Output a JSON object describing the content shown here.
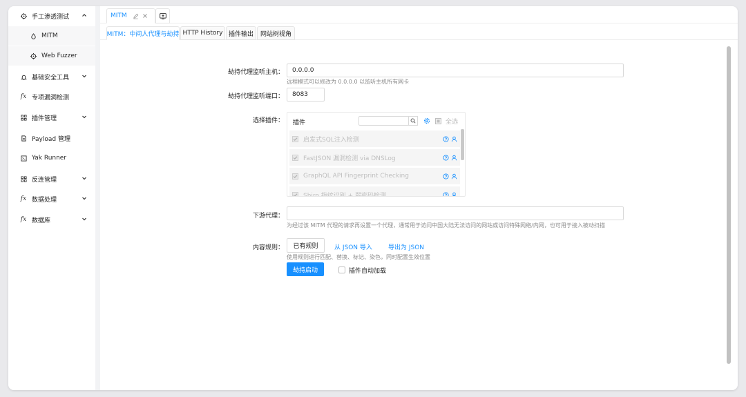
{
  "sidebar": {
    "items": [
      {
        "label": "手工渗透测试",
        "icon": "crosshair-icon",
        "expanded": true
      },
      {
        "label": "MITM",
        "icon": "drop-icon",
        "sub": true
      },
      {
        "label": "Web Fuzzer",
        "icon": "crosshair-icon",
        "sub": true
      },
      {
        "label": "基础安全工具",
        "icon": "bell-icon",
        "chevron": true
      },
      {
        "label": "专项漏洞检测",
        "icon": "fx-icon"
      },
      {
        "label": "插件管理",
        "icon": "grid-icon",
        "chevron": true
      },
      {
        "label": "Payload 管理",
        "icon": "file-icon"
      },
      {
        "label": "Yak Runner",
        "icon": "terminal-icon"
      },
      {
        "label": "反连管理",
        "icon": "grid-icon",
        "chevron": true
      },
      {
        "label": "数据处理",
        "icon": "fx-icon",
        "chevron": true
      },
      {
        "label": "数据库",
        "icon": "fx-icon",
        "chevron": true
      }
    ]
  },
  "tabs": {
    "main_tab": "MITM",
    "sub_tabs": [
      "MITM：中间人代理与劫持",
      "HTTP History",
      "插件输出",
      "网站树视角"
    ]
  },
  "form": {
    "host_label": "劫持代理监听主机：",
    "host_value": "0.0.0.0",
    "host_help": "远程模式可以修改为 0.0.0.0 以监听主机所有网卡",
    "port_label": "劫持代理监听端口：",
    "port_value": "8083",
    "plugin_label": "选择插件：",
    "plugin_box": {
      "title": "插件",
      "select_all": "全选",
      "items": [
        "启发式SQL注入检测",
        "FastJSON 漏洞检测 via DNSLog",
        "GraphQL API Fingerprint Checking",
        "Shiro 指纹识别 + 弱密码检测"
      ]
    },
    "downstream_label": "下游代理：",
    "downstream_value": "",
    "downstream_help": "为经过该 MITM 代理的请求再设置一个代理，通常用于访问中国大陆无法访问的网站或访问特殊网络/内网，也可用于接入被动扫描",
    "rules_label": "内容规则：",
    "rules_button": "已有规则",
    "import_json": "从 JSON 导入",
    "export_json": "导出为 JSON",
    "rules_help": "使用规则进行匹配、替换、标记、染色，同时配置生效位置",
    "start_button": "劫持启动",
    "auto_load_label": "插件自动加载"
  },
  "colors": {
    "accent": "#1890ff"
  }
}
